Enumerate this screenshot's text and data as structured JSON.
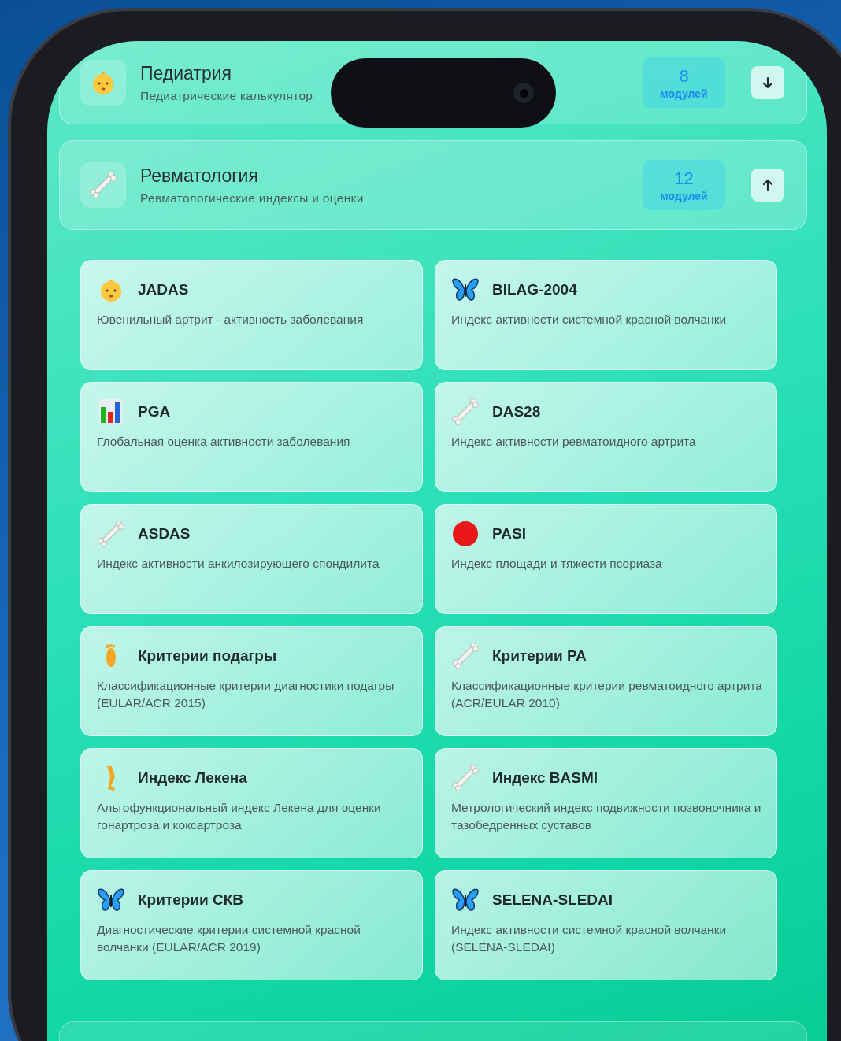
{
  "sections": [
    {
      "kind": "baby",
      "title": "Педиатрия",
      "subtitle": "Педиатрические калькулятор",
      "count": "8",
      "count_label": "модулей",
      "expanded": false
    },
    {
      "kind": "bone",
      "title": "Ревматология",
      "subtitle": "Ревматологические индексы и оценки",
      "count": "12",
      "count_label": "модулей",
      "expanded": true,
      "modules": [
        {
          "kind": "baby",
          "title": "JADAS",
          "description": "Ювенильный артрит - активность заболевания"
        },
        {
          "kind": "butterfly",
          "title": "BILAG-2004",
          "description": "Индекс активности системной красной волчанки"
        },
        {
          "kind": "chart",
          "title": "PGA",
          "description": "Глобальная оценка активности заболевания"
        },
        {
          "kind": "bone",
          "title": "DAS28",
          "description": "Индекс активности ревматоидного артрита"
        },
        {
          "kind": "bone",
          "title": "ASDAS",
          "description": "Индекс активности анкилозирующего спондилита"
        },
        {
          "kind": "red-circle",
          "title": "PASI",
          "description": "Индекс площади и тяжести псориаза"
        },
        {
          "kind": "foot",
          "title": "Критерии подагры",
          "description": "Классификационные критерии диагностики подагры (EULAR/ACR 2015)"
        },
        {
          "kind": "bone",
          "title": "Критерии РА",
          "description": "Классификационные критерии ревматоидного артрита (ACR/EULAR 2010)"
        },
        {
          "kind": "leg",
          "title": "Индекс Лекена",
          "description": "Альгофункциональный индекс Лекена для оценки гонартроза и коксартроза"
        },
        {
          "kind": "bone",
          "title": "Индекс BASMI",
          "description": "Метрологический индекс подвижности позвоночника и тазобедренных суставов"
        },
        {
          "kind": "butterfly",
          "title": "Критерии СКВ",
          "description": "Диагностические критерии системной красной волчанки (EULAR/ACR 2019)"
        },
        {
          "kind": "butterfly",
          "title": "SELENA-SLEDAI",
          "description": "Индекс активности системной красной волчанки (SELENA-SLEDAI)"
        }
      ]
    }
  ]
}
